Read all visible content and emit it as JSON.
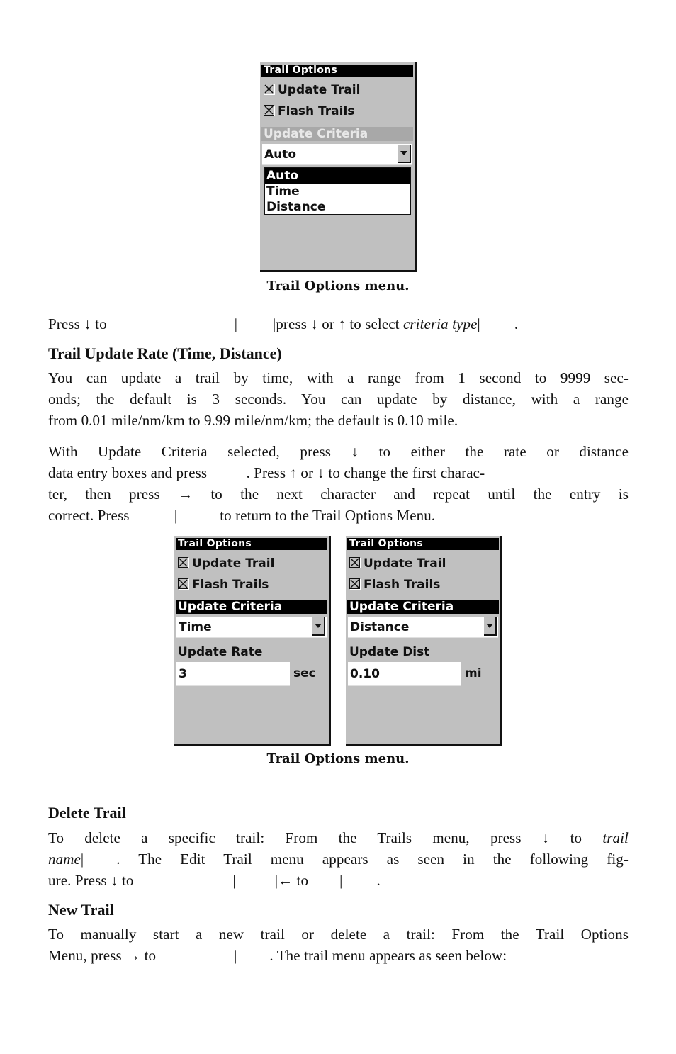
{
  "figure1": {
    "screen": {
      "title": "Trail Options",
      "checkboxes": [
        {
          "label": "Update Trail",
          "checked": true
        },
        {
          "label": "Flash Trails",
          "checked": true
        }
      ],
      "section_label": "Update Criteria",
      "dropdown_value": "Auto",
      "dropdown_options": [
        "Auto",
        "Time",
        "Distance"
      ],
      "dropdown_selected_index": 0
    },
    "caption": "Trail Options menu."
  },
  "instruction1": {
    "part1": "Press ",
    "arrow_down": "↓",
    "part2": " to",
    "sep1": "|",
    "sep2": "|",
    "part3": "press ",
    "part4": " or ",
    "arrow_up": "↑",
    "part5": " to select ",
    "italic": "criteria type",
    "sep3": "|",
    "end": "."
  },
  "section_rate": {
    "heading": "Trail Update Rate (Time, Distance)",
    "para1_lines": [
      "You can update a trail by time, with a range from 1 second to 9999 sec-",
      "onds; the default is 3 seconds. You can update by distance, with a range",
      "from 0.01 mile/nm/km to 9.99 mile/nm/km; the default is 0.10 mile."
    ],
    "para2": {
      "l1a": "With Update Criteria selected, press ",
      "l1b": " to either the rate or distance",
      "l2a": "data entry boxes and press ",
      "l2b": ". Press ",
      "l2c": " or ",
      "l2d": " to change the first charac-",
      "l3a": "ter, then press ",
      "arrow_right": "→",
      "l3b": " to the next character and repeat until the entry is",
      "l4a": "correct. Press ",
      "l4sep": "|",
      "l4b": "to return to the Trail Options Menu."
    }
  },
  "figure2": {
    "screens": [
      {
        "title": "Trail Options",
        "checkboxes": [
          {
            "label": "Update Trail",
            "checked": true
          },
          {
            "label": "Flash Trails",
            "checked": true
          }
        ],
        "section_label": "Update Criteria",
        "dropdown_value": "Time",
        "field_label": "Update Rate",
        "field_value": "3",
        "unit": "sec"
      },
      {
        "title": "Trail Options",
        "checkboxes": [
          {
            "label": "Update Trail",
            "checked": true
          },
          {
            "label": "Flash Trails",
            "checked": true
          }
        ],
        "section_label": "Update Criteria",
        "dropdown_value": "Distance",
        "field_label": "Update Dist",
        "field_value": "0.10",
        "unit": "mi"
      }
    ],
    "caption": "Trail Options menu."
  },
  "section_delete": {
    "heading": "Delete Trail",
    "l1a": "To delete a specific trail: From the Trails menu, press ",
    "l1b": " to ",
    "l1i": "trail",
    "l2i": "name",
    "l2sep": "|",
    "l2b": ". The Edit Trail menu appears as seen in the following fig-",
    "l3a": "ure. Press ",
    "l3b": " to",
    "l3sep1": "|",
    "l3sep2": "|",
    "arrow_left": "←",
    "l3c": " to",
    "l3sep3": "|",
    "l3end": "."
  },
  "section_new": {
    "heading": "New Trail",
    "l1": "To manually start a new trail or delete a trail: From the Trail Options",
    "l2a": "Menu, press ",
    "l2b": " to",
    "l2sep": "|",
    "l2c": ". The trail menu appears as seen below:"
  }
}
